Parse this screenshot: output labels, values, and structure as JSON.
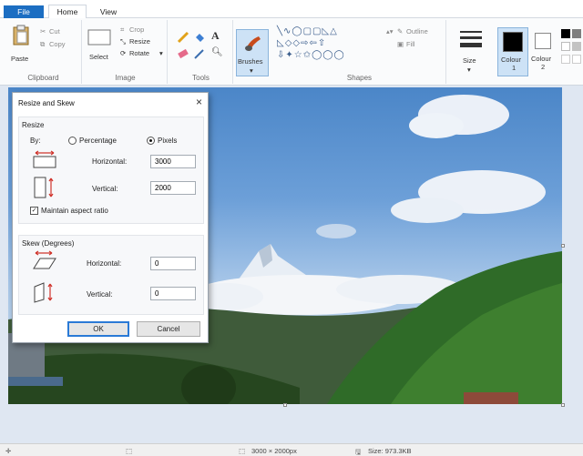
{
  "tabs": {
    "file": "File",
    "home": "Home",
    "view": "View"
  },
  "clipboard": {
    "paste": "Paste",
    "cut": "Cut",
    "copy": "Copy",
    "label": "Clipboard"
  },
  "image": {
    "select": "Select",
    "crop": "Crop",
    "resize": "Resize",
    "rotate": "Rotate",
    "label": "Image"
  },
  "tools": {
    "label": "Tools"
  },
  "brushes": {
    "label": "Brushes"
  },
  "shapes": {
    "outline": "Outline",
    "fill": "Fill",
    "label": "Shapes"
  },
  "size": {
    "label": "Size"
  },
  "colours": {
    "colour1": "Colour",
    "colour1_num": "1",
    "colour2": "Colour",
    "colour2_num": "2"
  },
  "status": {
    "dimensions": "3000 × 2000px",
    "file_size": "Size: 973.3KB"
  },
  "dialog": {
    "title": "Resize and Skew",
    "resize_heading": "Resize",
    "by": "By:",
    "percentage": "Percentage",
    "pixels": "Pixels",
    "horizontal": "Horizontal:",
    "vertical": "Vertical:",
    "resize_h": "3000",
    "resize_v": "2000",
    "maintain": "Maintain aspect ratio",
    "skew_heading": "Skew (Degrees)",
    "skew_h_label": "Horizontal:",
    "skew_v_label": "Vertical:",
    "skew_h": "0",
    "skew_v": "0",
    "ok": "OK",
    "cancel": "Cancel"
  }
}
